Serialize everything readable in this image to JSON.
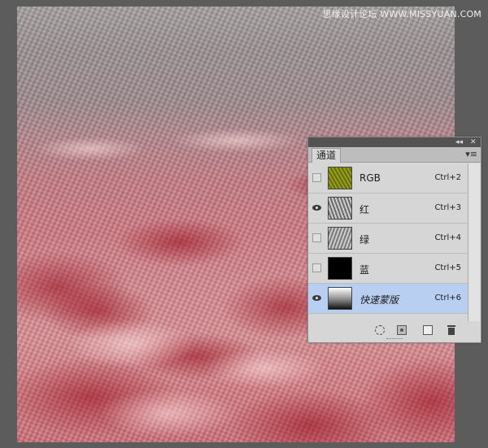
{
  "watermark": "思缘设计论坛 WWW.MISSYUAN.COM",
  "panel": {
    "collapse_icon": "double-chevron-left",
    "close_icon": "close",
    "tab_label": "通道",
    "menu_icon": "panel-menu"
  },
  "channels": [
    {
      "name": "RGB",
      "shortcut": "Ctrl+2",
      "visible": false,
      "thumb": "rgb",
      "selected": false
    },
    {
      "name": "红",
      "shortcut": "Ctrl+3",
      "visible": true,
      "thumb": "red",
      "selected": false
    },
    {
      "name": "绿",
      "shortcut": "Ctrl+4",
      "visible": false,
      "thumb": "green",
      "selected": false
    },
    {
      "name": "蓝",
      "shortcut": "Ctrl+5",
      "visible": false,
      "thumb": "blue",
      "selected": false
    },
    {
      "name": "快速蒙版",
      "shortcut": "Ctrl+6",
      "visible": true,
      "thumb": "mask",
      "selected": true
    }
  ],
  "footer_icons": [
    "load-selection-icon",
    "save-selection-icon",
    "new-channel-icon",
    "delete-channel-icon"
  ]
}
